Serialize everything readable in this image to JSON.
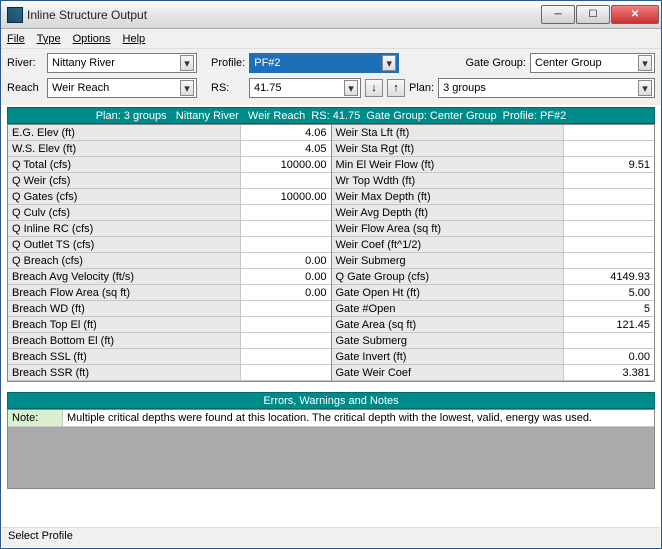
{
  "window": {
    "title": "Inline Structure Output"
  },
  "menu": {
    "file": "File",
    "type": "Type",
    "options": "Options",
    "help": "Help"
  },
  "controls": {
    "river_lbl": "River:",
    "river": "Nittany River",
    "profile_lbl": "Profile:",
    "profile": "PF#2",
    "gategroup_lbl": "Gate Group:",
    "gategroup": "Center Group",
    "reach_lbl": "Reach",
    "reach": "Weir Reach",
    "rs_lbl": "RS:",
    "rs": "41.75",
    "plan_lbl": "Plan:",
    "plan": "3 groups"
  },
  "header": "Plan: 3 groups   Nittany River   Weir Reach  RS: 41.75  Gate Group: Center Group  Profile: PF#2",
  "left": [
    {
      "k": "E.G. Elev (ft)",
      "v": "4.06"
    },
    {
      "k": "W.S. Elev (ft)",
      "v": "4.05"
    },
    {
      "k": "Q Total (cfs)",
      "v": "10000.00"
    },
    {
      "k": "Q Weir (cfs)",
      "v": ""
    },
    {
      "k": "Q Gates (cfs)",
      "v": "10000.00"
    },
    {
      "k": "Q Culv (cfs)",
      "v": ""
    },
    {
      "k": "Q Inline RC (cfs)",
      "v": ""
    },
    {
      "k": "Q Outlet TS (cfs)",
      "v": ""
    },
    {
      "k": "Q Breach (cfs)",
      "v": "0.00"
    },
    {
      "k": "Breach Avg Velocity (ft/s)",
      "v": "0.00"
    },
    {
      "k": "Breach Flow Area (sq ft)",
      "v": "0.00"
    },
    {
      "k": "Breach WD (ft)",
      "v": ""
    },
    {
      "k": "Breach Top El (ft)",
      "v": ""
    },
    {
      "k": "Breach Bottom El (ft)",
      "v": ""
    },
    {
      "k": "Breach SSL (ft)",
      "v": ""
    },
    {
      "k": "Breach SSR (ft)",
      "v": ""
    }
  ],
  "right": [
    {
      "k": "Weir Sta Lft (ft)",
      "v": ""
    },
    {
      "k": "Weir Sta Rgt (ft)",
      "v": ""
    },
    {
      "k": "Min El Weir Flow (ft)",
      "v": "9.51"
    },
    {
      "k": "Wr Top Wdth (ft)",
      "v": ""
    },
    {
      "k": "Weir Max Depth (ft)",
      "v": ""
    },
    {
      "k": "Weir Avg Depth (ft)",
      "v": ""
    },
    {
      "k": "Weir Flow Area (sq ft)",
      "v": ""
    },
    {
      "k": "Weir Coef (ft^1/2)",
      "v": ""
    },
    {
      "k": "Weir Submerg",
      "v": ""
    },
    {
      "k": "Q Gate Group (cfs)",
      "v": "4149.93"
    },
    {
      "k": "Gate Open Ht (ft)",
      "v": "5.00"
    },
    {
      "k": "Gate #Open",
      "v": "5"
    },
    {
      "k": "Gate Area (sq ft)",
      "v": "121.45"
    },
    {
      "k": "Gate Submerg",
      "v": ""
    },
    {
      "k": "Gate Invert (ft)",
      "v": "0.00"
    },
    {
      "k": "Gate Weir Coef",
      "v": "3.381"
    }
  ],
  "errors": {
    "header": "Errors, Warnings and Notes",
    "rows": [
      {
        "k": "Note:",
        "v": "Multiple critical depths were found at this location.  The critical depth with the lowest, valid, energy was used."
      }
    ]
  },
  "status": "Select Profile",
  "chart_data": {
    "type": "table",
    "title": "Inline Structure Output — Plan: 3 groups, Nittany River, Weir Reach, RS 41.75, Gate Group: Center Group, Profile PF#2",
    "left_column": {
      "E.G. Elev (ft)": 4.06,
      "W.S. Elev (ft)": 4.05,
      "Q Total (cfs)": 10000.0,
      "Q Weir (cfs)": null,
      "Q Gates (cfs)": 10000.0,
      "Q Culv (cfs)": null,
      "Q Inline RC (cfs)": null,
      "Q Outlet TS (cfs)": null,
      "Q Breach (cfs)": 0.0,
      "Breach Avg Velocity (ft/s)": 0.0,
      "Breach Flow Area (sq ft)": 0.0,
      "Breach WD (ft)": null,
      "Breach Top El (ft)": null,
      "Breach Bottom El (ft)": null,
      "Breach SSL (ft)": null,
      "Breach SSR (ft)": null
    },
    "right_column": {
      "Weir Sta Lft (ft)": null,
      "Weir Sta Rgt (ft)": null,
      "Min El Weir Flow (ft)": 9.51,
      "Wr Top Wdth (ft)": null,
      "Weir Max Depth (ft)": null,
      "Weir Avg Depth (ft)": null,
      "Weir Flow Area (sq ft)": null,
      "Weir Coef (ft^1/2)": null,
      "Weir Submerg": null,
      "Q Gate Group (cfs)": 4149.93,
      "Gate Open Ht (ft)": 5.0,
      "Gate #Open": 5,
      "Gate Area (sq ft)": 121.45,
      "Gate Submerg": null,
      "Gate Invert (ft)": 0.0,
      "Gate Weir Coef": 3.381
    }
  }
}
